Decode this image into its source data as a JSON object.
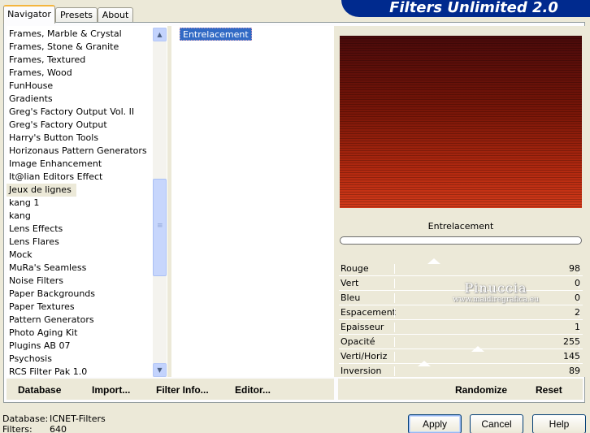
{
  "window": {
    "title": "Filters Unlimited 2.0"
  },
  "tabs": [
    {
      "label": "Navigator",
      "active": true
    },
    {
      "label": "Presets",
      "active": false
    },
    {
      "label": "About",
      "active": false
    }
  ],
  "categories": [
    "Frames, Marble & Crystal",
    "Frames, Stone & Granite",
    "Frames, Textured",
    "Frames, Wood",
    "FunHouse",
    "Gradients",
    "Greg's Factory Output Vol. II",
    "Greg's Factory Output",
    "Harry's Button Tools",
    "Horizonaus Pattern Generators",
    "Image Enhancement",
    "It@lian Editors Effect",
    "Jeux de lignes",
    "kang 1",
    "kang",
    "Lens Effects",
    "Lens Flares",
    "Mock",
    "MuRa's Seamless",
    "Noise Filters",
    "Paper Backgrounds",
    "Paper Textures",
    "Pattern Generators",
    "Photo Aging Kit",
    "Plugins AB 07",
    "Psychosis",
    "RCS Filter Pak 1.0"
  ],
  "selected_category": "Jeux de lignes",
  "filters": [
    "Entrelacement"
  ],
  "selected_filter": "Entrelacement",
  "preview": {
    "filter_name": "Entrelacement"
  },
  "parameters": [
    {
      "label": "Rouge",
      "value": "98"
    },
    {
      "label": "Vert",
      "value": "0"
    },
    {
      "label": "Bleu",
      "value": "0"
    },
    {
      "label": "Espacement",
      "value": "2"
    },
    {
      "label": "Epaisseur",
      "value": "1"
    },
    {
      "label": "Opacité",
      "value": "255"
    },
    {
      "label": "Verti/Horiz",
      "value": "145"
    },
    {
      "label": "Inversion",
      "value": "89"
    }
  ],
  "watermark": {
    "title": "Pinuccia",
    "url": "www.maidiregrafica.eu"
  },
  "links": {
    "database": "Database",
    "import": "Import...",
    "filter_info": "Filter Info...",
    "editor": "Editor...",
    "randomize": "Randomize",
    "reset": "Reset"
  },
  "status": {
    "database_label": "Database:",
    "database_value": "ICNET-Filters",
    "filters_label": "Filters:",
    "filters_value": "640"
  },
  "buttons": {
    "apply": "Apply",
    "cancel": "Cancel",
    "help": "Help"
  },
  "icons": {
    "scroll_up": "arrow-up-icon",
    "scroll_down": "arrow-down-icon",
    "thumb_grip": "grip-icon"
  },
  "colors": {
    "banner": "#002a8e",
    "selection": "#316ac5",
    "preview_top": "#4a0a0a",
    "preview_bottom": "#d23a1a"
  }
}
